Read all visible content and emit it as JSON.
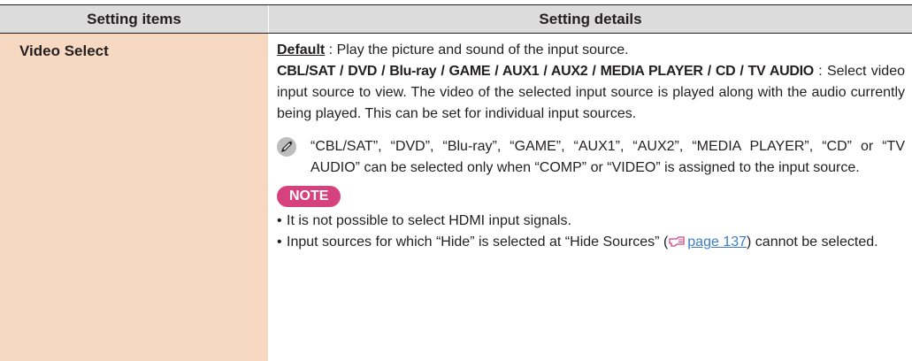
{
  "table": {
    "header": {
      "col1": "Setting items",
      "col2": "Setting details"
    },
    "row": {
      "item": "Video Select",
      "default_label": "Default",
      "default_text": " : Play the picture and sound of the input source.",
      "options_label": "CBL/SAT / DVD / Blu-ray / GAME / AUX1 / AUX2 / MEDIA PLAYER / CD / TV AUDIO",
      "options_text": " : Select video input source to view. The video of the selected input source is played along with the audio currently being played. This can be set for individual input sources.",
      "pencil_note": "“CBL/SAT”, “DVD”, “Blu-ray”, “GAME”, “AUX1”, “AUX2”, “MEDIA PLAYER”, “CD” or “TV AUDIO” can be selected only when “COMP” or “VIDEO” is assigned to the input source.",
      "note_badge": "NOTE",
      "bullet_char": "•",
      "bullet1": "It is not possible to select HDMI input signals.",
      "bullet2_before": "Input sources for which “Hide” is selected at “Hide Sources” (",
      "bullet2_link": "page 137",
      "bullet2_after": ") cannot be selected."
    }
  },
  "icons": {
    "note": "pencil-icon",
    "page_ref": "page-reference-hand-icon"
  },
  "colors": {
    "header_bg": "#dcdcdc",
    "item_bg": "#f7d9c2",
    "note_badge_bg": "#d6427e",
    "link": "#3b7dc4"
  }
}
